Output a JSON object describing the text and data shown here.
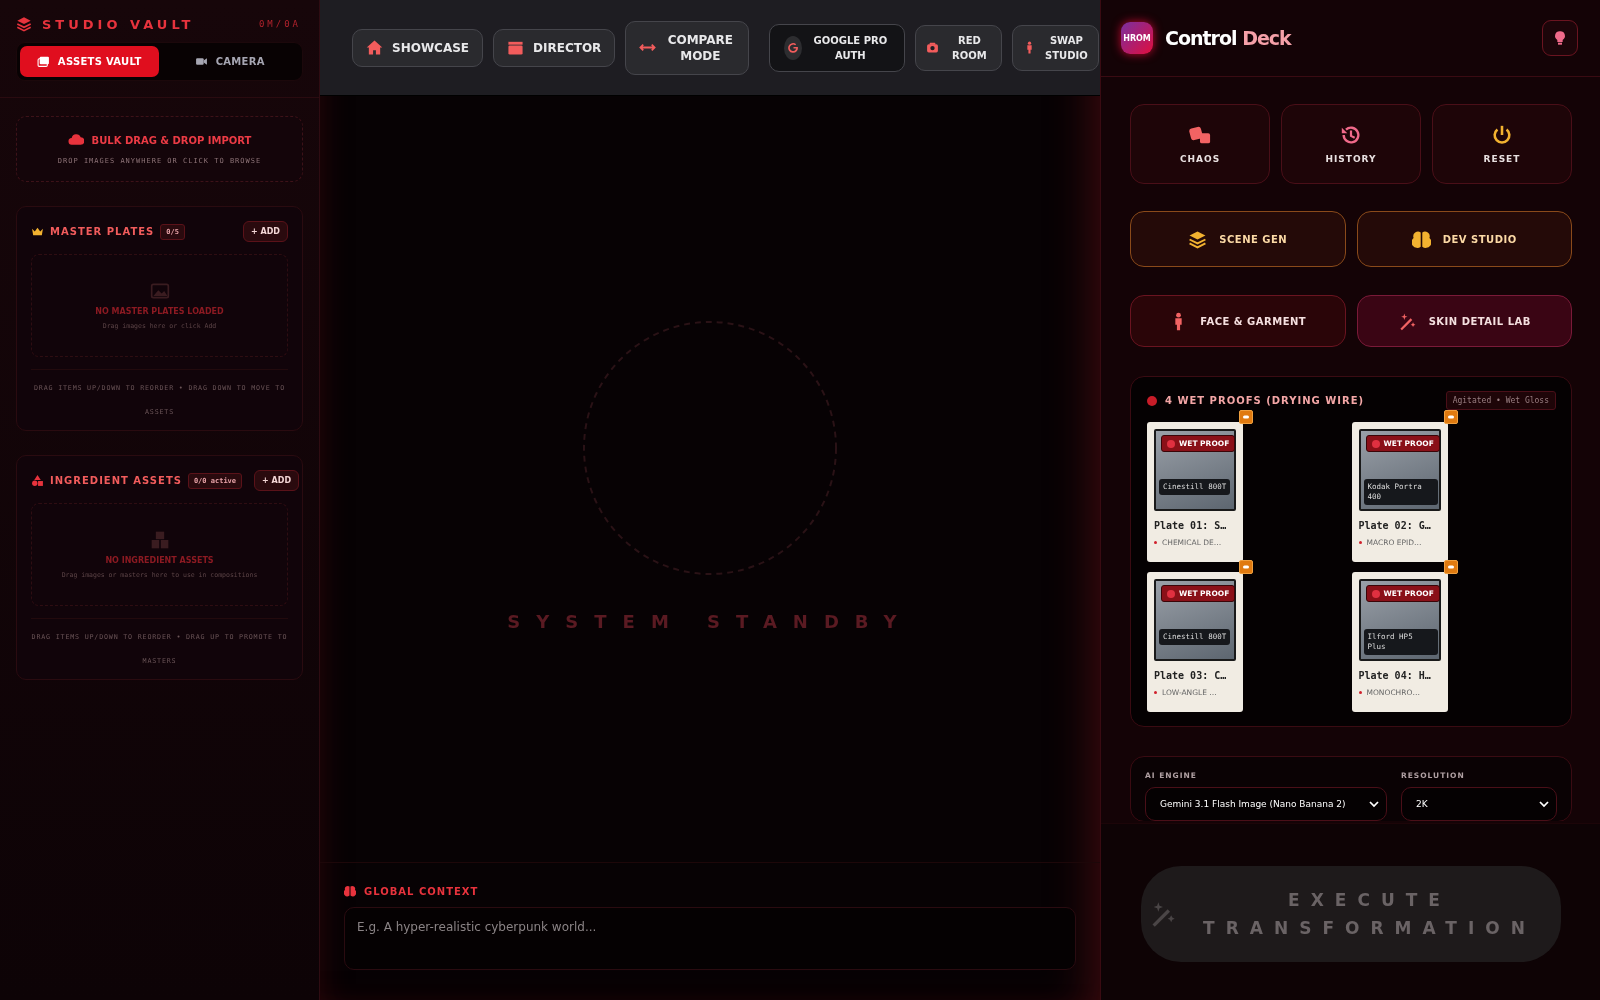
{
  "sidebar": {
    "title": "STUDIO VAULT",
    "counter": "0M/0A",
    "tabs": [
      {
        "label": "ASSETS VAULT",
        "selected": true
      },
      {
        "label": "CAMERA",
        "selected": false
      }
    ],
    "import": {
      "title": "BULK DRAG & DROP IMPORT",
      "hint": "DROP IMAGES ANYWHERE OR CLICK TO BROWSE"
    },
    "sections": [
      {
        "title": "MASTER PLATES",
        "count": "0/5",
        "add": "+ ADD",
        "empty_title": "NO MASTER PLATES LOADED",
        "empty_hint": "Drag images here or click Add",
        "footer": "DRAG ITEMS UP/DOWN TO REORDER • DRAG DOWN TO MOVE TO ASSETS"
      },
      {
        "title": "INGREDIENT ASSETS",
        "count": "0/0 active",
        "add": "+ ADD",
        "empty_title": "NO INGREDIENT ASSETS",
        "empty_hint": "Drag images or masters here to use in compositions",
        "footer": "DRAG ITEMS UP/DOWN TO REORDER • DRAG UP TO PROMOTE TO MASTERS"
      }
    ]
  },
  "toolbar": [
    {
      "label": "SHOWCASE",
      "kind": "nav"
    },
    {
      "label": "DIRECTOR",
      "kind": "nav"
    },
    {
      "label": "COMPARE MODE",
      "kind": "nav"
    },
    {
      "label": "GOOGLE PRO AUTH",
      "kind": "auth"
    },
    {
      "label": "RED ROOM",
      "kind": "small"
    },
    {
      "label": "SWAP STUDIO",
      "kind": "small"
    }
  ],
  "stage": {
    "status": "SYSTEM STANDBY"
  },
  "context": {
    "title": "GLOBAL CONTEXT",
    "placeholder": "E.g. A hyper-realistic cyberpunk world..."
  },
  "deck": {
    "badge": "HROM",
    "title": "Control",
    "title_accent": "Deck",
    "actions": [
      {
        "label": "CHAOS"
      },
      {
        "label": "HISTORY"
      },
      {
        "label": "RESET"
      }
    ],
    "modes": [
      {
        "label": "SCENE GEN",
        "kind": "gold"
      },
      {
        "label": "DEV STUDIO",
        "kind": "gold"
      },
      {
        "label": "FACE & GARMENT",
        "kind": "red"
      },
      {
        "label": "SKIN DETAIL LAB",
        "kind": "pink"
      }
    ],
    "proofs": {
      "title": "4 WET PROOFS (DRYING WIRE)",
      "tag": "Agitated • Wet Gloss",
      "plates": [
        {
          "badge": "WET PROOF",
          "film": "Cinestill 800T",
          "title": "Plate 01: S…",
          "subtitle": "CHEMICAL DE…"
        },
        {
          "badge": "WET PROOF",
          "film": "Kodak Portra 400",
          "title": "Plate 02: G…",
          "subtitle": "MACRO EPID…"
        },
        {
          "badge": "WET PROOF",
          "film": "Cinestill 800T",
          "title": "Plate 03: C…",
          "subtitle": "LOW-ANGLE …"
        },
        {
          "badge": "WET PROOF",
          "film": "Ilford HP5 Plus",
          "title": "Plate 04: H…",
          "subtitle": "MONOCHRO…"
        }
      ]
    },
    "settings": [
      {
        "label": "AI ENGINE",
        "value": "Gemini 3.1 Flash Image (Nano Banana 2)"
      },
      {
        "label": "RESOLUTION",
        "value": "2K"
      }
    ],
    "execute": {
      "label": "EXECUTE TRANSFORMATION",
      "disabled": true
    }
  }
}
